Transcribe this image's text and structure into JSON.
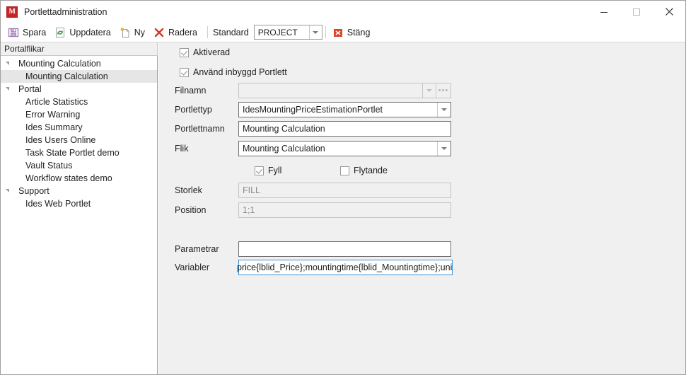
{
  "window": {
    "title": "Portlettadministration",
    "app_icon": "app-logo-icon",
    "minimize_label": "minimize-icon",
    "maximize_label": "maximize-icon",
    "close_label": "close-icon"
  },
  "toolbar": {
    "save_label": "Spara",
    "refresh_label": "Uppdatera",
    "new_label": "Ny",
    "delete_label": "Radera",
    "standard_label": "Standard",
    "standard_value": "PROJECT",
    "close_label": "Stäng"
  },
  "sidebar": {
    "header": "Portalflikar",
    "items": [
      {
        "label": "Mounting Calculation",
        "type": "group",
        "expanded": true,
        "selected": false
      },
      {
        "label": "Mounting Calculation",
        "type": "child",
        "selected": true
      },
      {
        "label": "Portal",
        "type": "group",
        "expanded": true,
        "selected": false
      },
      {
        "label": "Article Statistics",
        "type": "child",
        "selected": false
      },
      {
        "label": "Error Warning",
        "type": "child",
        "selected": false
      },
      {
        "label": "Ides Summary",
        "type": "child",
        "selected": false
      },
      {
        "label": "Ides Users Online",
        "type": "child",
        "selected": false
      },
      {
        "label": "Task State Portlet demo",
        "type": "child",
        "selected": false
      },
      {
        "label": "Vault Status",
        "type": "child",
        "selected": false
      },
      {
        "label": "Workflow states demo",
        "type": "child",
        "selected": false
      },
      {
        "label": "Support",
        "type": "group",
        "expanded": true,
        "selected": false
      },
      {
        "label": "Ides Web Portlet",
        "type": "child",
        "selected": false
      }
    ]
  },
  "form": {
    "enabled_checkbox": {
      "label": "Aktiverad",
      "checked": true
    },
    "builtin_checkbox": {
      "label": "Använd inbyggd Portlett",
      "checked": true
    },
    "filename": {
      "label": "Filnamn",
      "value": "",
      "enabled": false
    },
    "portlet_type": {
      "label": "Portlettyp",
      "value": "IdesMountingPriceEstimationPortlet"
    },
    "portlet_name": {
      "label": "Portlettnamn",
      "value": "Mounting Calculation"
    },
    "tab": {
      "label": "Flik",
      "value": "Mounting Calculation"
    },
    "fill_checkbox": {
      "label": "Fyll",
      "checked": true
    },
    "floating_checkbox": {
      "label": "Flytande",
      "checked": false
    },
    "size": {
      "label": "Storlek",
      "value": "FILL",
      "enabled": false
    },
    "position": {
      "label": "Position",
      "value": "1;1",
      "enabled": false
    },
    "parameters": {
      "label": "Parametrar",
      "value": ""
    },
    "variables": {
      "label": "Variabler",
      "value": "price{lblid_Price};mountingtime{lblid_Mountingtime};unitBase",
      "focused": true
    }
  },
  "colors": {
    "accent_red": "#c62525",
    "close_icon_red": "#d9472b",
    "save_icon_purple": "#b08fc4",
    "refresh_icon_green": "#4f9d4f",
    "panel_bg": "#f0f0f0",
    "focus_blue": "#3a8fd4"
  }
}
